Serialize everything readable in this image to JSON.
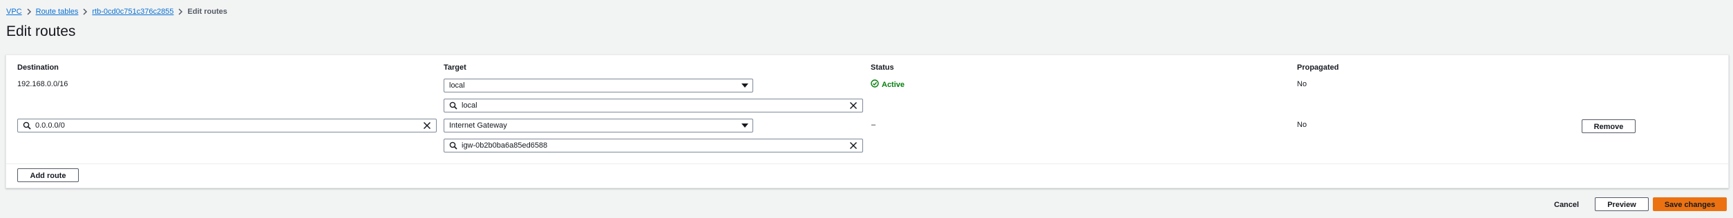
{
  "breadcrumb": {
    "items": [
      "VPC",
      "Route tables",
      "rtb-0cd0c751c376c2855"
    ],
    "current": "Edit routes"
  },
  "page": {
    "title": "Edit routes"
  },
  "table": {
    "headers": {
      "destination": "Destination",
      "target": "Target",
      "status": "Status",
      "propagated": "Propagated"
    },
    "rows": [
      {
        "destination": "192.168.0.0/16",
        "target_type": "local",
        "target_value": "local",
        "status": "Active",
        "propagated": "No"
      },
      {
        "destination": "0.0.0.0/0",
        "target_type": "Internet Gateway",
        "target_value": "igw-0b2b0ba6a85ed6588",
        "status": "–",
        "propagated": "No",
        "remove_label": "Remove"
      }
    ]
  },
  "actions": {
    "add_route": "Add route",
    "cancel": "Cancel",
    "preview": "Preview",
    "save": "Save changes"
  },
  "colors": {
    "link": "#0972d3",
    "active_status": "#037f0c",
    "primary_button": "#ec7211",
    "page_background": "#f2f3f3"
  },
  "icons": {
    "breadcrumb_separator": "chevron-right-icon",
    "status": "check-circle-icon",
    "search": "search-icon",
    "clear": "close-icon",
    "dropdown": "caret-down-icon"
  }
}
